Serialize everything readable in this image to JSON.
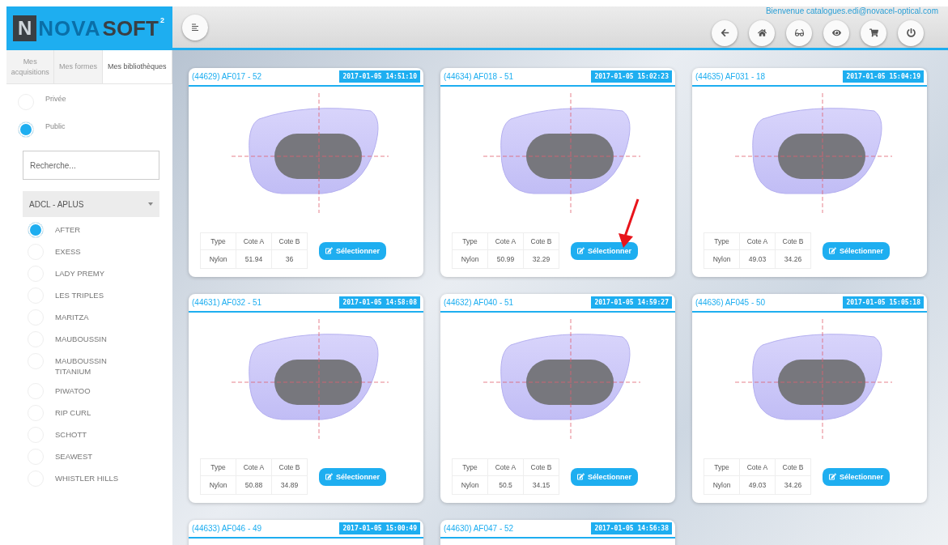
{
  "logo": {
    "mark": "N",
    "word_1": "NOVA",
    "word_2": "SOFT",
    "superscript": "2"
  },
  "header": {
    "welcome": "Bienvenue catalogues.edi@novacel-optical.com",
    "buttons": [
      {
        "kind": "back"
      },
      {
        "kind": "home"
      },
      {
        "kind": "glasses"
      },
      {
        "kind": "eye"
      },
      {
        "kind": "cart"
      },
      {
        "kind": "power"
      }
    ]
  },
  "sidebar": {
    "tabs": [
      {
        "label": "Mes acquisitions",
        "selected": false
      },
      {
        "label": "Mes formes",
        "selected": false
      },
      {
        "label": "Mes bibliothèques",
        "selected": true
      }
    ],
    "scope": [
      {
        "label": "Privée",
        "selected": false
      },
      {
        "label": "Public",
        "selected": true
      }
    ],
    "search": {
      "placeholder": "Recherche..."
    },
    "select": {
      "value": "ADCL - APLUS"
    },
    "brands": [
      {
        "label": "AFTER",
        "selected": true
      },
      {
        "label": "EXESS",
        "selected": false
      },
      {
        "label": "LADY PREMY",
        "selected": false
      },
      {
        "label": "LES TRIPLES",
        "selected": false
      },
      {
        "label": "MARITZA",
        "selected": false
      },
      {
        "label": "MAUBOUSSIN",
        "selected": false
      },
      {
        "label": "MAUBOUSSIN TITANIUM",
        "selected": false
      },
      {
        "label": "PIWATOO",
        "selected": false
      },
      {
        "label": "RIP CURL",
        "selected": false
      },
      {
        "label": "SCHOTT",
        "selected": false
      },
      {
        "label": "SEAWEST",
        "selected": false
      },
      {
        "label": "WHISTLER HILLS",
        "selected": false
      }
    ]
  },
  "cards": [
    {
      "title": "(44629) AF017 - 52",
      "timestamp": "2017-01-05 14:51:10",
      "table": {
        "columns": [
          "Type",
          "Cote A",
          "Cote B"
        ],
        "row": [
          "Nylon",
          "51.94",
          "36"
        ]
      },
      "button": "Sélectionner",
      "pointed": false
    },
    {
      "title": "(44634) AF018 - 51",
      "timestamp": "2017-01-05 15:02:23",
      "table": {
        "columns": [
          "Type",
          "Cote A",
          "Cote B"
        ],
        "row": [
          "Nylon",
          "50.99",
          "32.29"
        ]
      },
      "button": "Sélectionner",
      "pointed": true
    },
    {
      "title": "(44635) AF031 - 18",
      "timestamp": "2017-01-05 15:04:19",
      "table": {
        "columns": [
          "Type",
          "Cote A",
          "Cote B"
        ],
        "row": [
          "Nylon",
          "49.03",
          "34.26"
        ]
      },
      "button": "Sélectionner",
      "pointed": false
    },
    {
      "title": "(44631) AF032 - 51",
      "timestamp": "2017-01-05 14:58:08",
      "table": {
        "columns": [
          "Type",
          "Cote A",
          "Cote B"
        ],
        "row": [
          "Nylon",
          "50.88",
          "34.89"
        ]
      },
      "button": "Sélectionner",
      "pointed": false
    },
    {
      "title": "(44632) AF040 - 51",
      "timestamp": "2017-01-05 14:59:27",
      "table": {
        "columns": [
          "Type",
          "Cote A",
          "Cote B"
        ],
        "row": [
          "Nylon",
          "50.5",
          "34.15"
        ]
      },
      "button": "Sélectionner",
      "pointed": false
    },
    {
      "title": "(44636) AF045 - 50",
      "timestamp": "2017-01-05 15:05:18",
      "table": {
        "columns": [
          "Type",
          "Cote A",
          "Cote B"
        ],
        "row": [
          "Nylon",
          "49.03",
          "34.26"
        ]
      },
      "button": "Sélectionner",
      "pointed": false
    },
    {
      "title": "(44633) AF046 - 49",
      "timestamp": "2017-01-05 15:00:49"
    },
    {
      "title": "(44630) AF047 - 52",
      "timestamp": "2017-01-05 14:56:38"
    }
  ]
}
